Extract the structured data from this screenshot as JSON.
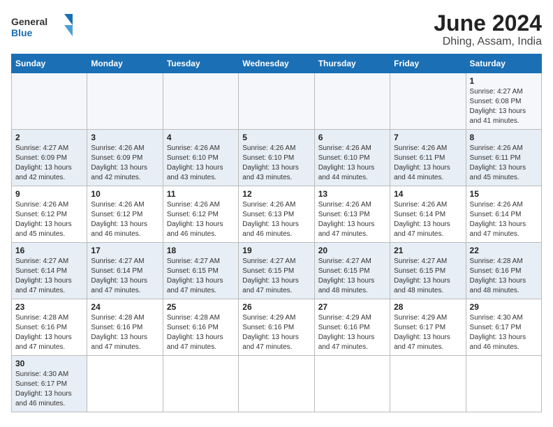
{
  "header": {
    "logo_general": "General",
    "logo_blue": "Blue",
    "title": "June 2024",
    "subtitle": "Dhing, Assam, India"
  },
  "weekdays": [
    "Sunday",
    "Monday",
    "Tuesday",
    "Wednesday",
    "Thursday",
    "Friday",
    "Saturday"
  ],
  "weeks": [
    [
      {
        "day": "",
        "info": ""
      },
      {
        "day": "",
        "info": ""
      },
      {
        "day": "",
        "info": ""
      },
      {
        "day": "",
        "info": ""
      },
      {
        "day": "",
        "info": ""
      },
      {
        "day": "",
        "info": ""
      },
      {
        "day": "1",
        "info": "Sunrise: 4:27 AM\nSunset: 6:08 PM\nDaylight: 13 hours and 41 minutes."
      }
    ],
    [
      {
        "day": "2",
        "info": "Sunrise: 4:27 AM\nSunset: 6:09 PM\nDaylight: 13 hours and 42 minutes."
      },
      {
        "day": "3",
        "info": "Sunrise: 4:26 AM\nSunset: 6:09 PM\nDaylight: 13 hours and 42 minutes."
      },
      {
        "day": "4",
        "info": "Sunrise: 4:26 AM\nSunset: 6:10 PM\nDaylight: 13 hours and 43 minutes."
      },
      {
        "day": "5",
        "info": "Sunrise: 4:26 AM\nSunset: 6:10 PM\nDaylight: 13 hours and 43 minutes."
      },
      {
        "day": "6",
        "info": "Sunrise: 4:26 AM\nSunset: 6:10 PM\nDaylight: 13 hours and 44 minutes."
      },
      {
        "day": "7",
        "info": "Sunrise: 4:26 AM\nSunset: 6:11 PM\nDaylight: 13 hours and 44 minutes."
      },
      {
        "day": "8",
        "info": "Sunrise: 4:26 AM\nSunset: 6:11 PM\nDaylight: 13 hours and 45 minutes."
      }
    ],
    [
      {
        "day": "9",
        "info": "Sunrise: 4:26 AM\nSunset: 6:12 PM\nDaylight: 13 hours and 45 minutes."
      },
      {
        "day": "10",
        "info": "Sunrise: 4:26 AM\nSunset: 6:12 PM\nDaylight: 13 hours and 46 minutes."
      },
      {
        "day": "11",
        "info": "Sunrise: 4:26 AM\nSunset: 6:12 PM\nDaylight: 13 hours and 46 minutes."
      },
      {
        "day": "12",
        "info": "Sunrise: 4:26 AM\nSunset: 6:13 PM\nDaylight: 13 hours and 46 minutes."
      },
      {
        "day": "13",
        "info": "Sunrise: 4:26 AM\nSunset: 6:13 PM\nDaylight: 13 hours and 47 minutes."
      },
      {
        "day": "14",
        "info": "Sunrise: 4:26 AM\nSunset: 6:14 PM\nDaylight: 13 hours and 47 minutes."
      },
      {
        "day": "15",
        "info": "Sunrise: 4:26 AM\nSunset: 6:14 PM\nDaylight: 13 hours and 47 minutes."
      }
    ],
    [
      {
        "day": "16",
        "info": "Sunrise: 4:27 AM\nSunset: 6:14 PM\nDaylight: 13 hours and 47 minutes."
      },
      {
        "day": "17",
        "info": "Sunrise: 4:27 AM\nSunset: 6:14 PM\nDaylight: 13 hours and 47 minutes."
      },
      {
        "day": "18",
        "info": "Sunrise: 4:27 AM\nSunset: 6:15 PM\nDaylight: 13 hours and 47 minutes."
      },
      {
        "day": "19",
        "info": "Sunrise: 4:27 AM\nSunset: 6:15 PM\nDaylight: 13 hours and 47 minutes."
      },
      {
        "day": "20",
        "info": "Sunrise: 4:27 AM\nSunset: 6:15 PM\nDaylight: 13 hours and 48 minutes."
      },
      {
        "day": "21",
        "info": "Sunrise: 4:27 AM\nSunset: 6:15 PM\nDaylight: 13 hours and 48 minutes."
      },
      {
        "day": "22",
        "info": "Sunrise: 4:28 AM\nSunset: 6:16 PM\nDaylight: 13 hours and 48 minutes."
      }
    ],
    [
      {
        "day": "23",
        "info": "Sunrise: 4:28 AM\nSunset: 6:16 PM\nDaylight: 13 hours and 47 minutes."
      },
      {
        "day": "24",
        "info": "Sunrise: 4:28 AM\nSunset: 6:16 PM\nDaylight: 13 hours and 47 minutes."
      },
      {
        "day": "25",
        "info": "Sunrise: 4:28 AM\nSunset: 6:16 PM\nDaylight: 13 hours and 47 minutes."
      },
      {
        "day": "26",
        "info": "Sunrise: 4:29 AM\nSunset: 6:16 PM\nDaylight: 13 hours and 47 minutes."
      },
      {
        "day": "27",
        "info": "Sunrise: 4:29 AM\nSunset: 6:16 PM\nDaylight: 13 hours and 47 minutes."
      },
      {
        "day": "28",
        "info": "Sunrise: 4:29 AM\nSunset: 6:17 PM\nDaylight: 13 hours and 47 minutes."
      },
      {
        "day": "29",
        "info": "Sunrise: 4:30 AM\nSunset: 6:17 PM\nDaylight: 13 hours and 46 minutes."
      }
    ],
    [
      {
        "day": "30",
        "info": "Sunrise: 4:30 AM\nSunset: 6:17 PM\nDaylight: 13 hours and 46 minutes."
      },
      {
        "day": "",
        "info": ""
      },
      {
        "day": "",
        "info": ""
      },
      {
        "day": "",
        "info": ""
      },
      {
        "day": "",
        "info": ""
      },
      {
        "day": "",
        "info": ""
      },
      {
        "day": "",
        "info": ""
      }
    ]
  ]
}
